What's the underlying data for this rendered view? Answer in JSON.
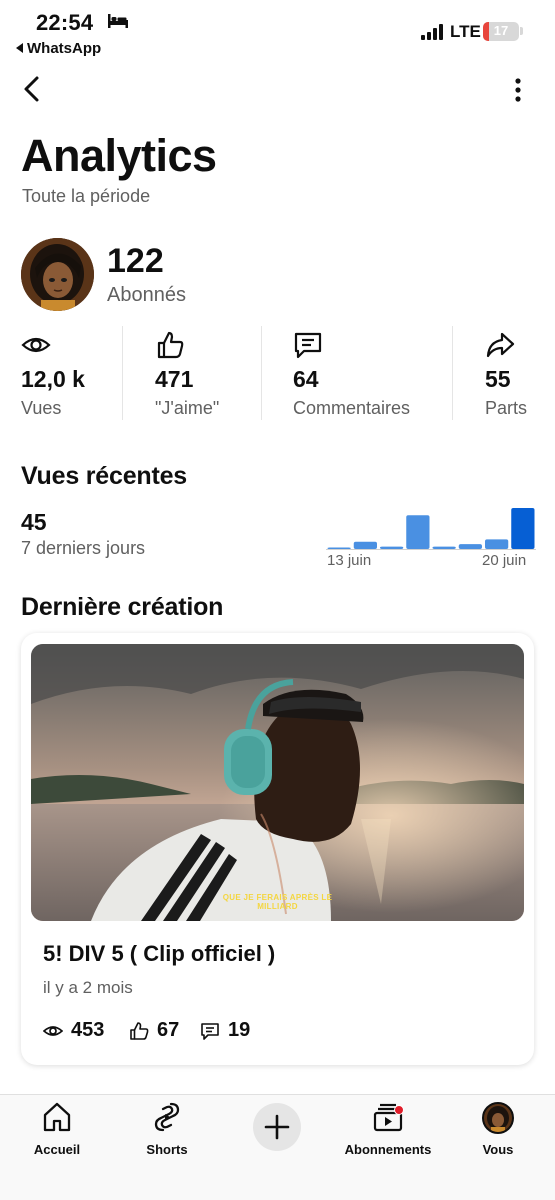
{
  "status_bar": {
    "time": "22:54",
    "back_app": "WhatsApp",
    "network": "LTE",
    "battery": "17",
    "battery_fraction": 0.17,
    "battery_color": "#e8453c"
  },
  "header": {
    "title": "Analytics",
    "subtitle": "Toute la période",
    "back_icon": "chevron-left-icon",
    "menu_icon": "more-vert-icon"
  },
  "profile": {
    "subscribers": "122",
    "subscribers_label": "Abonnés"
  },
  "stats": [
    {
      "icon": "eye-icon",
      "value": "12,0 k",
      "label": "Vues"
    },
    {
      "icon": "thumb-up-icon",
      "value": "471",
      "label": "\"J'aime\""
    },
    {
      "icon": "comment-icon",
      "value": "64",
      "label": "Commentaires"
    },
    {
      "icon": "share-icon",
      "value": "55",
      "label": "Parts"
    }
  ],
  "recent_views": {
    "title": "Vues récentes",
    "value": "45",
    "period": "7 derniers jours",
    "start_label": "13 juin",
    "end_label": "20 juin",
    "bar_color": "#4a90e2",
    "highlight_color": "#065fd4"
  },
  "chart_data": {
    "type": "bar",
    "categories": [
      "13 juin",
      "14 juin",
      "15 juin",
      "16 juin",
      "17 juin",
      "18 juin",
      "19 juin",
      "20 juin"
    ],
    "values": [
      0,
      3,
      1,
      14,
      1,
      2,
      4,
      17
    ],
    "xlabel": "",
    "ylabel": "",
    "ylim": [
      0,
      17
    ],
    "grid": false
  },
  "latest": {
    "title": "Dernière création",
    "video_title": "5! DIV 5 ( Clip officiel )",
    "time": "il y a 2 mois",
    "caption_line1": "QUE JE FERAIS APRÈS LE",
    "caption_line2": "MILLIARD",
    "stats": [
      {
        "icon": "eye-icon",
        "value": "453"
      },
      {
        "icon": "thumb-up-icon",
        "value": "67"
      },
      {
        "icon": "comment-icon",
        "value": "19"
      }
    ]
  },
  "bottom_nav": [
    {
      "icon": "home-icon",
      "label": "Accueil"
    },
    {
      "icon": "shorts-icon",
      "label": "Shorts"
    },
    {
      "icon": "plus-icon",
      "label": ""
    },
    {
      "icon": "subscriptions-icon",
      "label": "Abonnements"
    },
    {
      "icon": "avatar-icon",
      "label": "Vous"
    }
  ]
}
